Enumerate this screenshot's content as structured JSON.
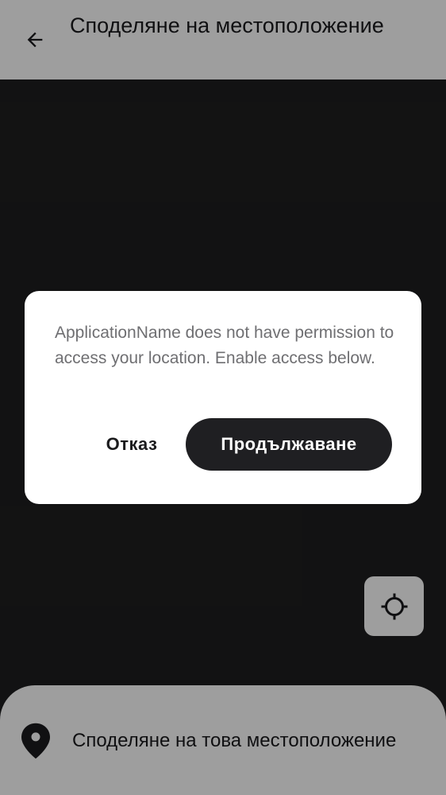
{
  "header": {
    "back_icon": "arrow-left-icon",
    "title": "Споделяне на местоположение"
  },
  "map": {
    "locate_icon": "crosshair-icon"
  },
  "bottom_sheet": {
    "pin_icon": "location-pin-icon",
    "share_label": "Споделяне на това местоположение"
  },
  "dialog": {
    "message": "ApplicationName does not have permission to access your location. Enable access below.",
    "cancel_label": "Отказ",
    "continue_label": "Продължаване"
  },
  "colors": {
    "primary_dark": "#1f1f22",
    "surface": "#ffffff",
    "map_background": "#1e1e1f",
    "message_text": "#6f6f72"
  }
}
